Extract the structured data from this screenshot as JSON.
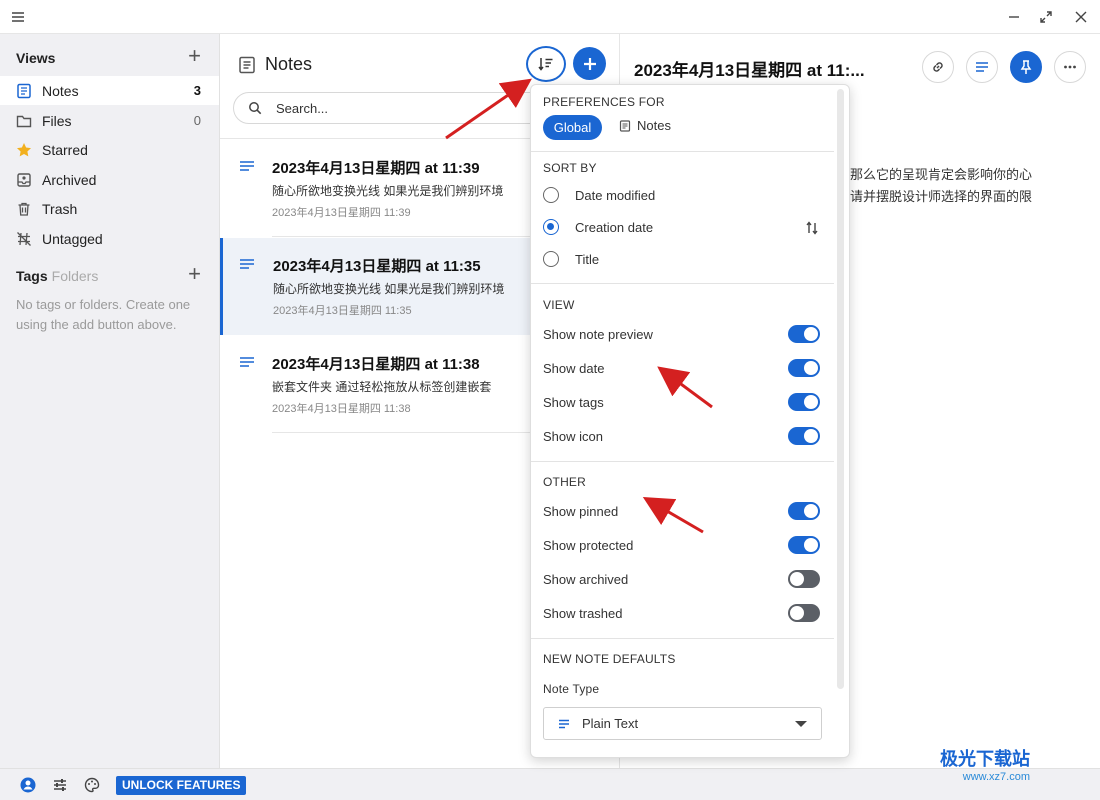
{
  "sidebar": {
    "views_label": "Views",
    "items": [
      {
        "label": "Notes",
        "count": "3"
      },
      {
        "label": "Files",
        "count": "0"
      },
      {
        "label": "Starred",
        "count": ""
      },
      {
        "label": "Archived",
        "count": ""
      },
      {
        "label": "Trash",
        "count": ""
      },
      {
        "label": "Untagged",
        "count": ""
      }
    ],
    "tags_label": "Tags",
    "folders_label": "Folders",
    "tags_empty": "No tags or folders. Create one using the add button above."
  },
  "notes_pane": {
    "title": "Notes",
    "search_placeholder": "Search...",
    "notes": [
      {
        "title": "2023年4月13日星期四 at 11:39",
        "preview": "随心所欲地变换光线 如果光是我们辨别环境",
        "date": "2023年4月13日星期四 11:39"
      },
      {
        "title": "2023年4月13日星期四 at 11:35",
        "preview": "随心所欲地变换光线 如果光是我们辨别环境",
        "date": "2023年4月13日星期四 11:35"
      },
      {
        "title": "2023年4月13日星期四 at 11:38",
        "preview": "嵌套文件夹 通过轻松拖放从标签创建嵌套",
        "date": "2023年4月13日星期四 11:38"
      }
    ]
  },
  "editor": {
    "title": "2023年4月13日星期四 at 11:...",
    "body_line1": "那么它的呈现肯定会影响你的心",
    "body_line2": "请并摆脱设计师选择的界面的限"
  },
  "preferences": {
    "header": "PREFERENCES FOR",
    "global_label": "Global",
    "notes_label": "Notes",
    "sort_by_label": "SORT BY",
    "sort_options": [
      {
        "label": "Date modified",
        "checked": false
      },
      {
        "label": "Creation date",
        "checked": true
      },
      {
        "label": "Title",
        "checked": false
      }
    ],
    "view_label": "VIEW",
    "view_toggles": [
      {
        "label": "Show note preview",
        "on": true
      },
      {
        "label": "Show date",
        "on": true
      },
      {
        "label": "Show tags",
        "on": true
      },
      {
        "label": "Show icon",
        "on": true
      }
    ],
    "other_label": "OTHER",
    "other_toggles": [
      {
        "label": "Show pinned",
        "on": true
      },
      {
        "label": "Show protected",
        "on": true
      },
      {
        "label": "Show archived",
        "on": false
      },
      {
        "label": "Show trashed",
        "on": false
      }
    ],
    "defaults_label": "NEW NOTE DEFAULTS",
    "note_type_label": "Note Type",
    "note_type_value": "Plain Text"
  },
  "bottombar": {
    "unlock_label": "UNLOCK FEATURES"
  },
  "watermark": {
    "title": "极光下载站",
    "url": "www.xz7.com"
  },
  "colors": {
    "accent": "#1a66d2",
    "annotation_arrow": "#d42020"
  }
}
